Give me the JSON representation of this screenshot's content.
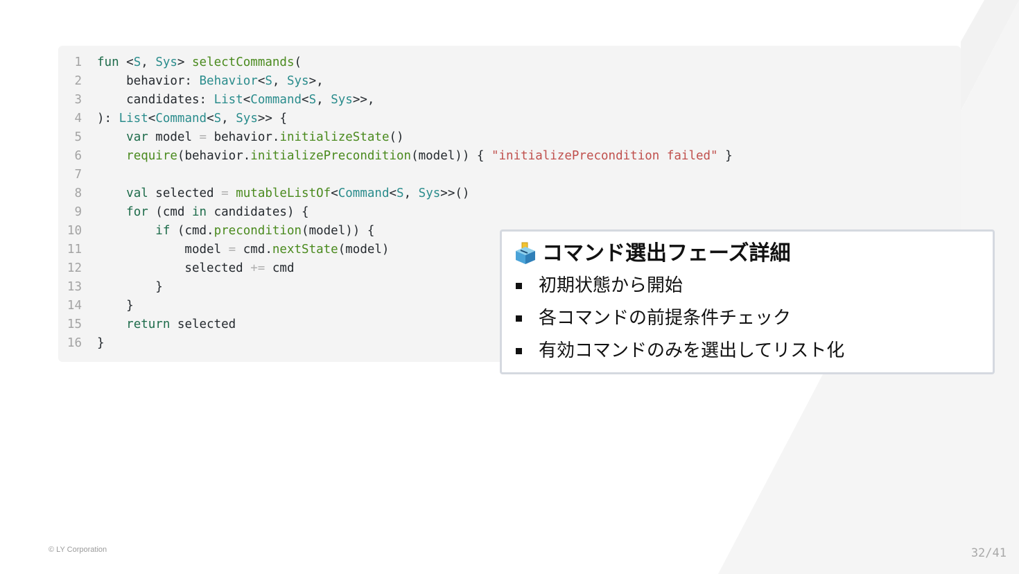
{
  "code": {
    "lines": [
      {
        "num": "1",
        "tokens": [
          {
            "t": "fun",
            "c": "kw"
          },
          {
            "t": " <"
          },
          {
            "t": "S",
            "c": "ty"
          },
          {
            "t": ", "
          },
          {
            "t": "Sys",
            "c": "ty"
          },
          {
            "t": "> "
          },
          {
            "t": "selectCommands",
            "c": "fn"
          },
          {
            "t": "("
          }
        ]
      },
      {
        "num": "2",
        "tokens": [
          {
            "t": "    behavior: "
          },
          {
            "t": "Behavior",
            "c": "ty"
          },
          {
            "t": "<"
          },
          {
            "t": "S",
            "c": "ty"
          },
          {
            "t": ", "
          },
          {
            "t": "Sys",
            "c": "ty"
          },
          {
            "t": ">,"
          }
        ]
      },
      {
        "num": "3",
        "tokens": [
          {
            "t": "    candidates: "
          },
          {
            "t": "List",
            "c": "ty"
          },
          {
            "t": "<"
          },
          {
            "t": "Command",
            "c": "ty"
          },
          {
            "t": "<"
          },
          {
            "t": "S",
            "c": "ty"
          },
          {
            "t": ", "
          },
          {
            "t": "Sys",
            "c": "ty"
          },
          {
            "t": ">>,"
          }
        ]
      },
      {
        "num": "4",
        "tokens": [
          {
            "t": "): "
          },
          {
            "t": "List",
            "c": "ty"
          },
          {
            "t": "<"
          },
          {
            "t": "Command",
            "c": "ty"
          },
          {
            "t": "<"
          },
          {
            "t": "S",
            "c": "ty"
          },
          {
            "t": ", "
          },
          {
            "t": "Sys",
            "c": "ty"
          },
          {
            "t": ">> {"
          }
        ]
      },
      {
        "num": "5",
        "tokens": [
          {
            "t": "    "
          },
          {
            "t": "var",
            "c": "kw"
          },
          {
            "t": " model "
          },
          {
            "t": "=",
            "c": "op"
          },
          {
            "t": " behavior."
          },
          {
            "t": "initializeState",
            "c": "fn"
          },
          {
            "t": "()"
          }
        ]
      },
      {
        "num": "6",
        "tokens": [
          {
            "t": "    "
          },
          {
            "t": "require",
            "c": "fn"
          },
          {
            "t": "(behavior."
          },
          {
            "t": "initializePrecondition",
            "c": "fn"
          },
          {
            "t": "(model)) { "
          },
          {
            "t": "\"initializePrecondition failed\"",
            "c": "st"
          },
          {
            "t": " }"
          }
        ]
      },
      {
        "num": "7",
        "tokens": []
      },
      {
        "num": "8",
        "tokens": [
          {
            "t": "    "
          },
          {
            "t": "val",
            "c": "kw"
          },
          {
            "t": " selected "
          },
          {
            "t": "=",
            "c": "op"
          },
          {
            "t": " "
          },
          {
            "t": "mutableListOf",
            "c": "fn"
          },
          {
            "t": "<"
          },
          {
            "t": "Command",
            "c": "ty"
          },
          {
            "t": "<"
          },
          {
            "t": "S",
            "c": "ty"
          },
          {
            "t": ", "
          },
          {
            "t": "Sys",
            "c": "ty"
          },
          {
            "t": ">>()"
          }
        ]
      },
      {
        "num": "9",
        "tokens": [
          {
            "t": "    "
          },
          {
            "t": "for",
            "c": "kw"
          },
          {
            "t": " (cmd "
          },
          {
            "t": "in",
            "c": "kw"
          },
          {
            "t": " candidates) {"
          }
        ]
      },
      {
        "num": "10",
        "tokens": [
          {
            "t": "        "
          },
          {
            "t": "if",
            "c": "kw"
          },
          {
            "t": " (cmd."
          },
          {
            "t": "precondition",
            "c": "fn"
          },
          {
            "t": "(model)) {"
          }
        ]
      },
      {
        "num": "11",
        "tokens": [
          {
            "t": "            model "
          },
          {
            "t": "=",
            "c": "op"
          },
          {
            "t": " cmd."
          },
          {
            "t": "nextState",
            "c": "fn"
          },
          {
            "t": "(model)"
          }
        ]
      },
      {
        "num": "12",
        "tokens": [
          {
            "t": "            selected "
          },
          {
            "t": "+=",
            "c": "op"
          },
          {
            "t": " cmd"
          }
        ]
      },
      {
        "num": "13",
        "tokens": [
          {
            "t": "        }"
          }
        ]
      },
      {
        "num": "14",
        "tokens": [
          {
            "t": "    }"
          }
        ]
      },
      {
        "num": "15",
        "tokens": [
          {
            "t": "    "
          },
          {
            "t": "return",
            "c": "kw"
          },
          {
            "t": " selected"
          }
        ]
      },
      {
        "num": "16",
        "tokens": [
          {
            "t": "}"
          }
        ]
      }
    ]
  },
  "callout": {
    "icon": "ballot-box-icon",
    "title": "コマンド選出フェーズ詳細",
    "bullets": [
      "初期状態から開始",
      "各コマンドの前提条件チェック",
      "有効コマンドのみを選出してリスト化"
    ]
  },
  "footer": {
    "copyright": "© LY Corporation",
    "page": "32/41"
  },
  "colors": {
    "code_bg": "#f4f4f4",
    "keyword": "#1d6b4a",
    "type": "#2a8c8c",
    "function": "#4a8a1e",
    "string": "#c0504d",
    "callout_border": "#d5d9e0"
  }
}
